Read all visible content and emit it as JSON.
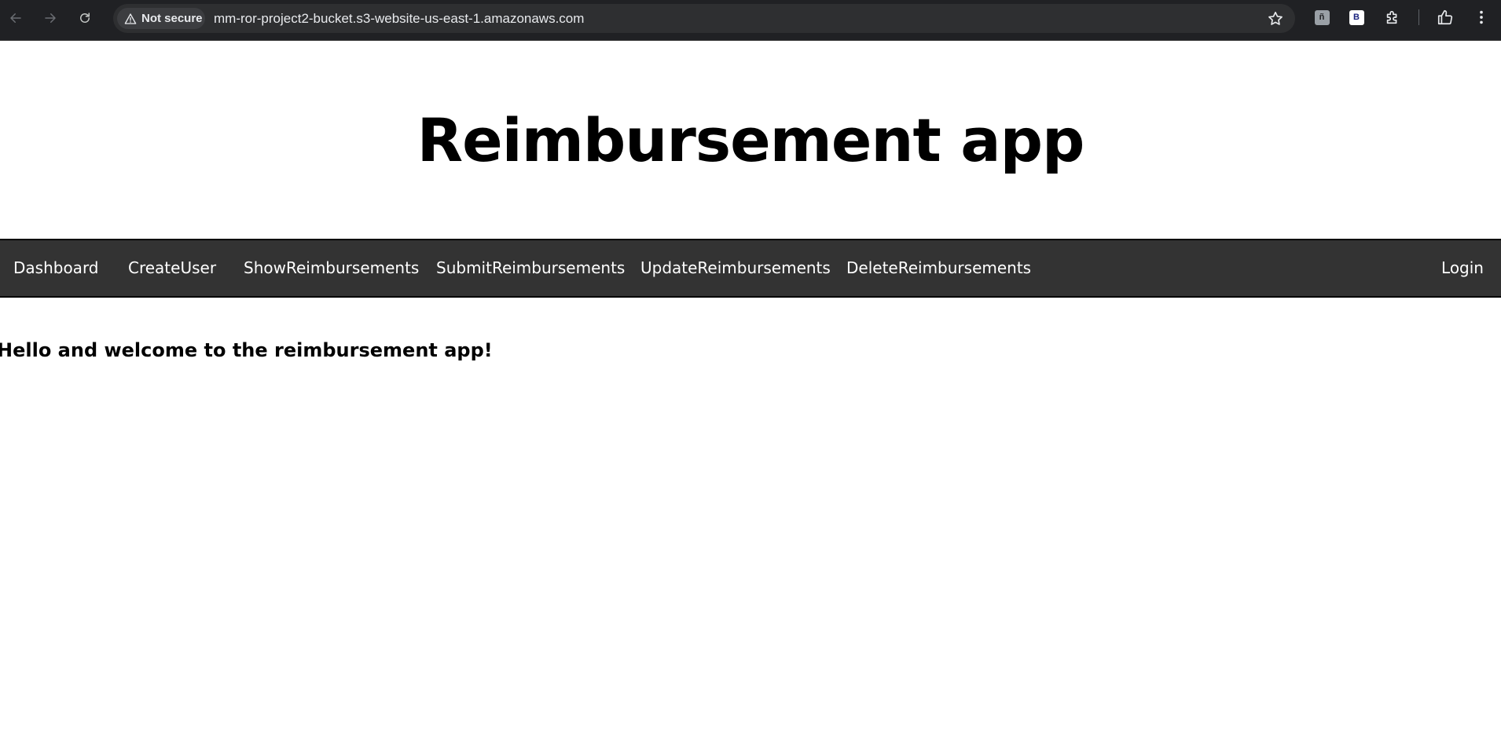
{
  "browser": {
    "security_label": "Not secure",
    "url": "mm-ror-project2-bucket.s3-website-us-east-1.amazonaws.com",
    "extensions": [
      {
        "glyph": "ñ"
      },
      {
        "glyph": "B"
      }
    ]
  },
  "header": {
    "title": "Reimbursement app"
  },
  "navbar": {
    "items": [
      {
        "label": "Dashboard"
      },
      {
        "label": "CreateUser"
      },
      {
        "label": "ShowReimbursements"
      },
      {
        "label": "SubmitReimbursements"
      },
      {
        "label": "UpdateReimbursements"
      },
      {
        "label": "DeleteReimbursements"
      }
    ],
    "login_label": "Login"
  },
  "main": {
    "welcome_text": "Hello and welcome to the reimbursement app!"
  },
  "colors": {
    "chrome_bg": "#202124",
    "navbar_bg": "#333333",
    "nav_text": "#ffffff"
  }
}
